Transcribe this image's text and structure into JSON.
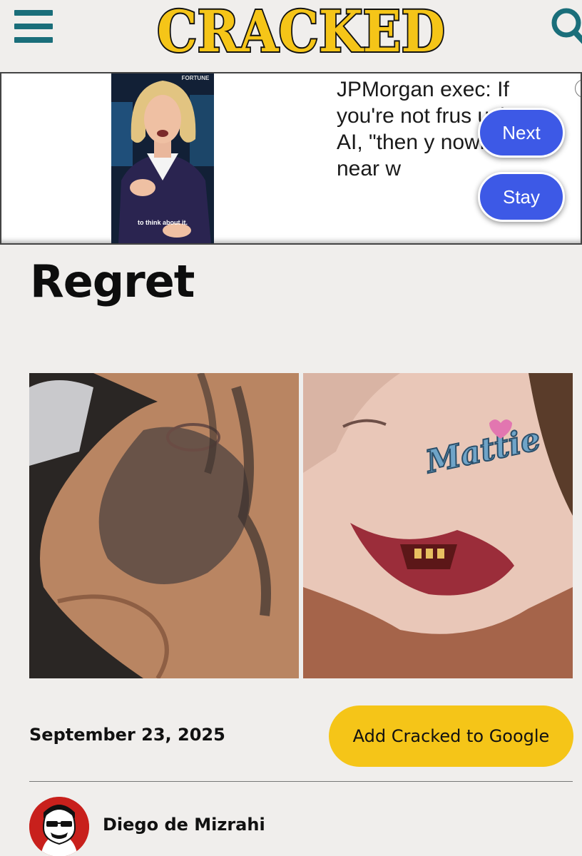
{
  "header": {
    "logo_text": "CRACKED",
    "menu_icon": "hamburger-menu-icon",
    "search_icon": "search-icon",
    "brand_color": "#f5c518",
    "accent_color": "#1a6e7a"
  },
  "ad": {
    "headline": "JPMorgan exec: If you're not frus using AI, \"then y nowhere near w",
    "image_brand": "FORTUNE",
    "image_caption": "to think about it.",
    "close_label": "×",
    "next_label": "Next",
    "stay_label": "Stay",
    "button_color": "#3d59e6"
  },
  "article": {
    "title": "Regret",
    "date": "September 23, 2025",
    "google_button_label": "Add Cracked to Google",
    "author": "Diego de Mizrahi"
  }
}
